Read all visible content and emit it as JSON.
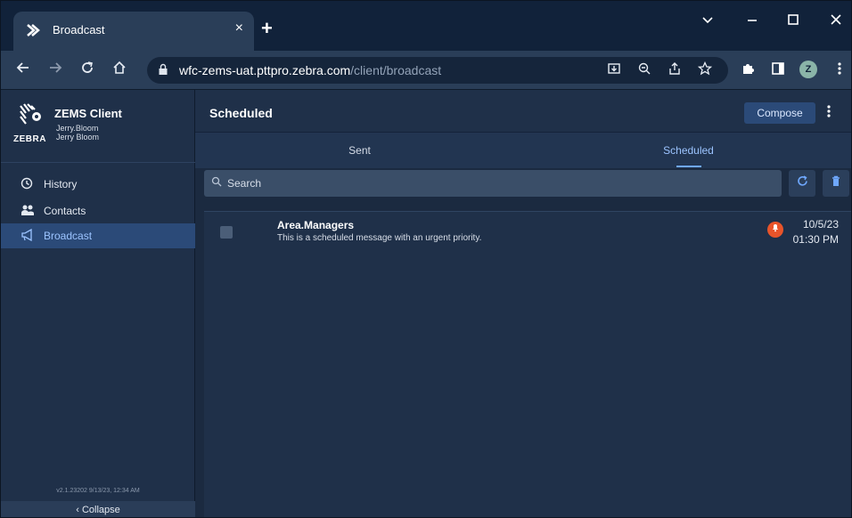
{
  "browser": {
    "tab_title": "Broadcast",
    "tab_close": "×",
    "new_tab": "+",
    "url_host": "wfc-zems-uat.pttpro.zebra.com",
    "url_path": "/client/broadcast",
    "profile_initial": "Z"
  },
  "sidebar": {
    "app_name": "ZEMS Client",
    "logo_text": "ZEBRA",
    "username": "Jerry.Bloom",
    "display_name": "Jerry Bloom",
    "items": [
      {
        "label": "History",
        "icon": "history-icon"
      },
      {
        "label": "Contacts",
        "icon": "contacts-icon"
      },
      {
        "label": "Broadcast",
        "icon": "broadcast-icon",
        "active": true
      }
    ],
    "version": "v2.1.23202 9/13/23, 12:34 AM",
    "collapse_label": "Collapse"
  },
  "main": {
    "title": "Scheduled",
    "compose_label": "Compose",
    "tabs": [
      {
        "label": "Sent",
        "active": false
      },
      {
        "label": "Scheduled",
        "active": true
      }
    ],
    "search_placeholder": "Search",
    "messages": [
      {
        "recipient": "Area.Managers",
        "body": "This is a scheduled message with an urgent priority.",
        "date": "10/5/23",
        "time": "01:30 PM",
        "priority": "urgent"
      }
    ]
  },
  "colors": {
    "accent": "#6fa8ff",
    "urgent": "#e8542a",
    "sidebar_active": "#2b4a78"
  }
}
